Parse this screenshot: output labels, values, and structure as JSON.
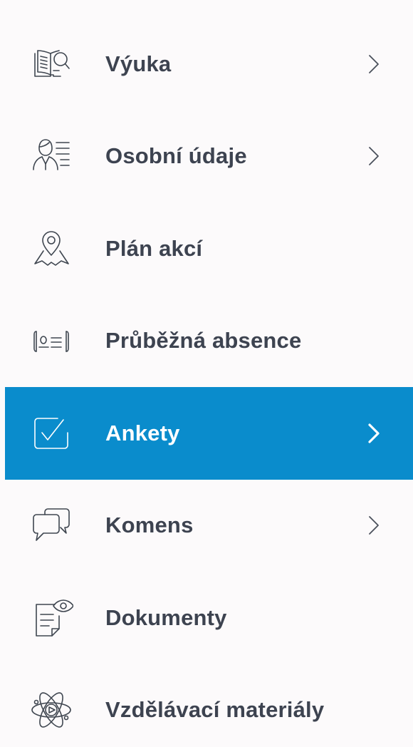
{
  "menu": {
    "items": [
      {
        "label": "Výuka",
        "icon": "book-search-icon",
        "has_chevron": true,
        "active": false
      },
      {
        "label": "Osobní údaje",
        "icon": "person-list-icon",
        "has_chevron": true,
        "active": false
      },
      {
        "label": "Plán akcí",
        "icon": "map-pin-icon",
        "has_chevron": false,
        "active": false
      },
      {
        "label": "Průběžná absence",
        "icon": "id-card-icon",
        "has_chevron": false,
        "active": false
      },
      {
        "label": "Ankety",
        "icon": "checkbox-icon",
        "has_chevron": true,
        "active": true
      },
      {
        "label": "Komens",
        "icon": "chat-bubbles-icon",
        "has_chevron": true,
        "active": false
      },
      {
        "label": "Dokumenty",
        "icon": "document-eye-icon",
        "has_chevron": false,
        "active": false
      },
      {
        "label": "Vzdělávací materiály",
        "icon": "atom-play-icon",
        "has_chevron": false,
        "active": false
      }
    ]
  },
  "colors": {
    "background": "#fcfafb",
    "active_background": "#0a8ccc",
    "text": "#3d4350",
    "active_text": "#ffffff"
  }
}
